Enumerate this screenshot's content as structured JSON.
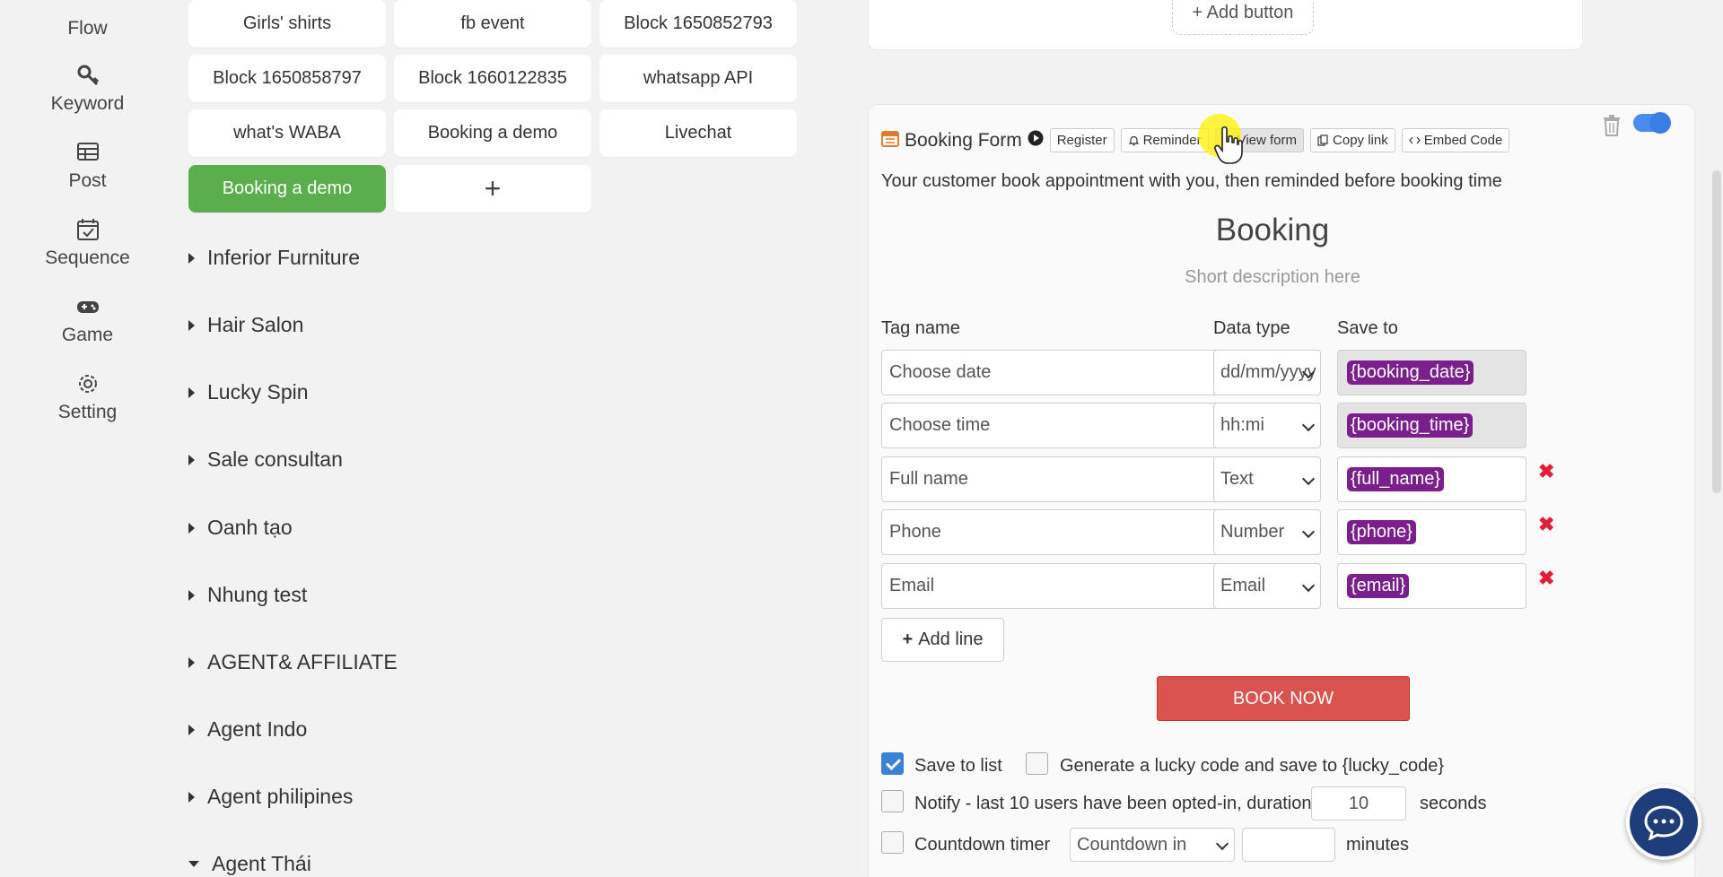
{
  "leftnav": {
    "items": [
      {
        "label": "Flow",
        "icon": "flow-icon"
      },
      {
        "label": "Keyword",
        "icon": "key-icon"
      },
      {
        "label": "Post",
        "icon": "post-icon"
      },
      {
        "label": "Sequence",
        "icon": "calendar-check-icon"
      },
      {
        "label": "Game",
        "icon": "gamepad-icon"
      },
      {
        "label": "Setting",
        "icon": "gear-icon"
      }
    ]
  },
  "blocks": {
    "row1": [
      "Girls' shirts",
      "fb event",
      "Block 1650852793"
    ],
    "row2": [
      "Block 1650858797",
      "Block 1660122835",
      "whatsapp API"
    ],
    "row3": [
      "what's WABA",
      "Booking a demo",
      "Livechat"
    ],
    "active": "Booking a demo",
    "add": "+"
  },
  "groups": [
    "Inferior Furniture",
    "Hair Salon",
    "Lucky Spin",
    "Sale consultan",
    "Oanh tạo",
    "Nhung test",
    "AGENT& AFFILIATE",
    "Agent Indo",
    "Agent philipines",
    "Agent Thái"
  ],
  "top_card": {
    "add_button": "+ Add button"
  },
  "booking_card": {
    "title": "Booking Form",
    "chips": {
      "register": "Register",
      "reminder": "Reminder",
      "view_form": "View form",
      "copy_link": "Copy link",
      "embed_code": "Embed Code"
    },
    "description": "Your customer book appointment with you, then reminded before booking time",
    "form_title": "Booking",
    "form_sub": "Short description here",
    "col_tag": "Tag name",
    "col_type": "Data type",
    "col_save": "Save to",
    "rows": [
      {
        "tag": "Choose date",
        "type": "dd/mm/yyyy",
        "save": "{booking_date}"
      },
      {
        "tag": "Choose time",
        "type": "hh:mi",
        "save": "{booking_time}"
      },
      {
        "tag": "Full name",
        "type": "Text",
        "save": "{full_name}"
      },
      {
        "tag": "Phone",
        "type": "Number",
        "save": "{phone}"
      },
      {
        "tag": "Email",
        "type": "Email",
        "save": "{email}"
      }
    ],
    "delete_mark": "✖",
    "add_line": "Add line",
    "book_now": "BOOK NOW",
    "options": {
      "save_to_list": "Save to list",
      "save_to_list_checked": true,
      "lucky_code": "Generate a lucky code and save to {lucky_code}",
      "notify": "Notify - last 10 users have been opted-in, duration",
      "notify_value": "10",
      "seconds": "seconds",
      "countdown": "Countdown timer",
      "countdown_select": "Countdown in",
      "minutes": "minutes"
    },
    "toggle_on": true
  },
  "colors": {
    "active_block": "#5aae4b",
    "book_now": "#d9534f",
    "tag_pill": "#7b1f8c",
    "toggle": "#4a8cf0",
    "chat_fab": "#1e3d7a"
  }
}
